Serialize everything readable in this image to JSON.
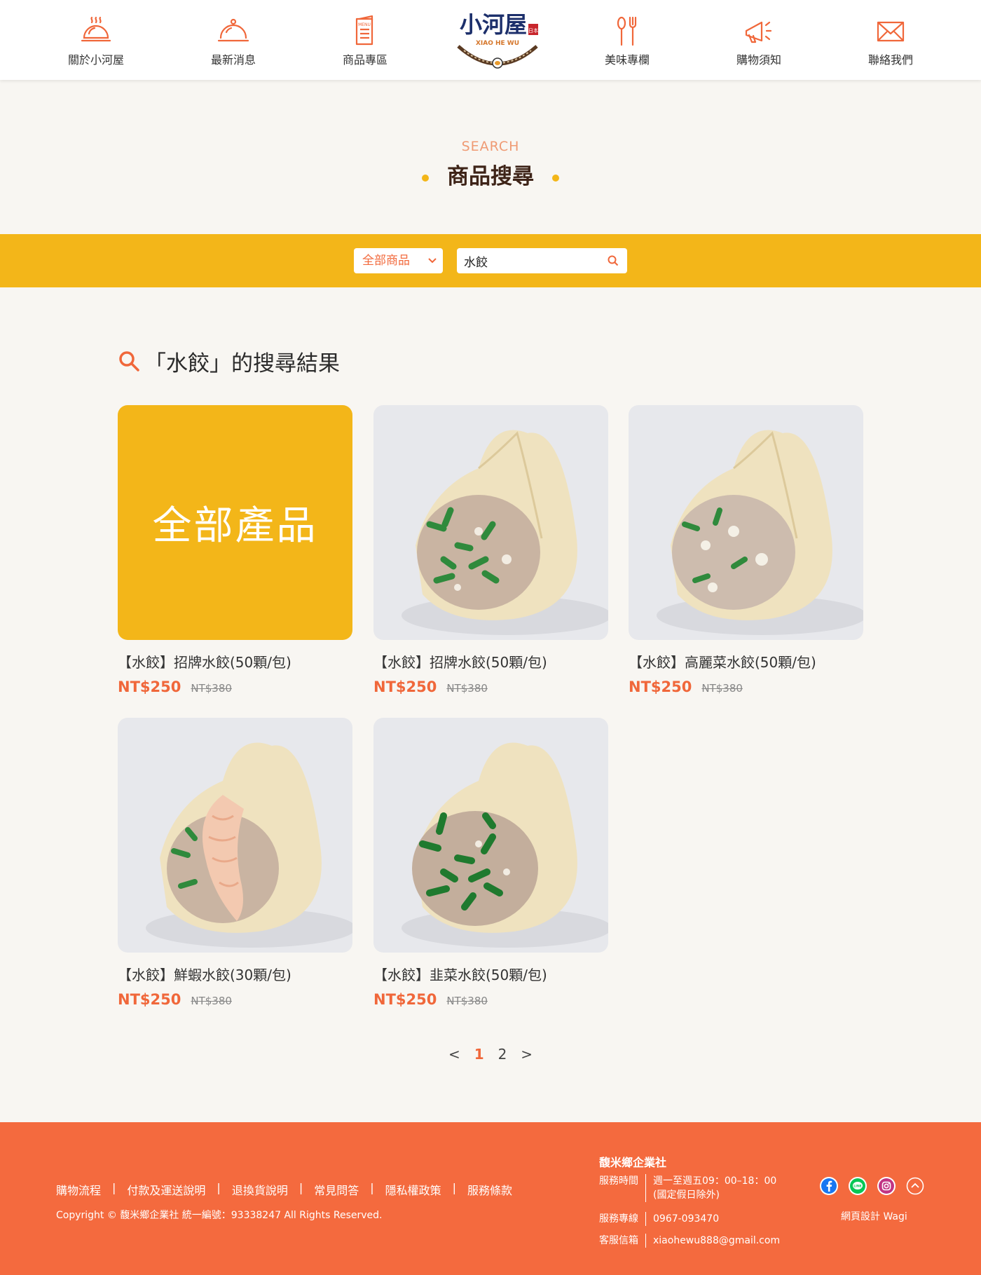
{
  "nav": {
    "items": [
      {
        "label": "關於小河屋",
        "icon": "steaming-bowl-icon"
      },
      {
        "label": "最新消息",
        "icon": "cloche-icon"
      },
      {
        "label": "商品專區",
        "icon": "menu-book-icon"
      },
      {
        "label": "美味專欄",
        "icon": "utensils-icon"
      },
      {
        "label": "購物須知",
        "icon": "megaphone-icon"
      },
      {
        "label": "聯絡我們",
        "icon": "envelope-icon"
      }
    ],
    "logo": {
      "title": "小河屋",
      "subtitle": "XIAO HE WU",
      "seal": "日本"
    }
  },
  "hero": {
    "en": "SEARCH",
    "zh": "商品搜尋"
  },
  "search": {
    "category": "全部商品",
    "query": "水餃"
  },
  "results": {
    "title": "「水餃」的搜尋結果",
    "all_label": "全部產品",
    "products": [
      {
        "name": "【水餃】招牌水餃(50顆/包)",
        "price": "NT$250",
        "original": "NT$380"
      },
      {
        "name": "【水餃】招牌水餃(50顆/包)",
        "price": "NT$250",
        "original": "NT$380"
      },
      {
        "name": "【水餃】高麗菜水餃(50顆/包)",
        "price": "NT$250",
        "original": "NT$380"
      },
      {
        "name": "【水餃】鮮蝦水餃(30顆/包)",
        "price": "NT$250",
        "original": "NT$380"
      },
      {
        "name": "【水餃】韭菜水餃(50顆/包)",
        "price": "NT$250",
        "original": "NT$380"
      }
    ]
  },
  "pagination": {
    "prev": "<",
    "pages": [
      "1",
      "2"
    ],
    "current": "1",
    "next": ">"
  },
  "footer": {
    "links": [
      "購物流程",
      "付款及運送說明",
      "退換貨說明",
      "常見問答",
      "隱私權政策",
      "服務條款"
    ],
    "separator": "|",
    "copyright": "Copyright © 馥米鄉企業社 統一編號：93338247 All Rights Reserved.",
    "company": "馥米鄉企業社",
    "hours_label": "服務時間",
    "hours_value": "週一至週五09：00–18：00",
    "hours_note": "(國定假日除外)",
    "phone_label": "服務專線",
    "phone_value": "0967-093470",
    "email_label": "客服信箱",
    "email_value": "xiaohewu888@gmail.com",
    "designer": "網頁設計 Wagi",
    "social_icons": [
      "facebook-icon",
      "line-icon",
      "instagram-icon",
      "back-to-top-icon"
    ]
  },
  "colors": {
    "brand_orange": "#f46a3e",
    "brand_yellow": "#f3b619",
    "title_brown": "#3e2418"
  }
}
